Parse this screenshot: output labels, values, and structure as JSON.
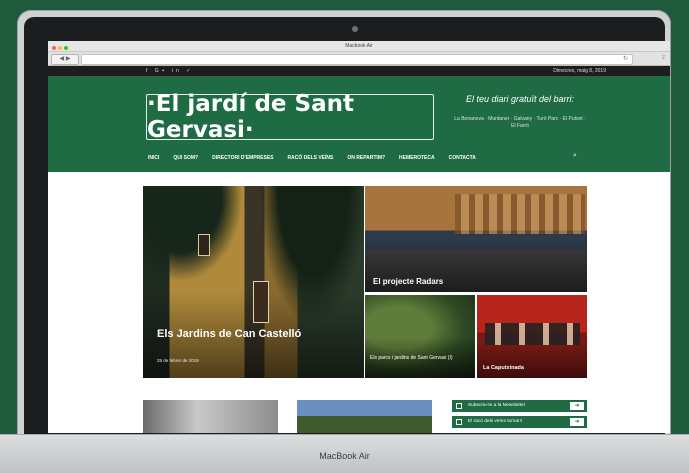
{
  "browser": {
    "window_title": "Macbook Air"
  },
  "site": {
    "social_icons": [
      "facebook-icon",
      "google-plus-icon",
      "linkedin-icon",
      "twitter-icon"
    ],
    "social_glyphs": "f G+ in ✓",
    "date": "Dimecres, maig 8, 2019",
    "logo": "·El jardí de Sant Gervasi·",
    "tagline": "El teu diari gratuït del barri:",
    "tagline_sub": "La Bonanova · Muntaner · Galvany · Turó Parc · El Putxet · El Farró",
    "nav": [
      "INICI",
      "QUI SOM?",
      "DIRECTORI D'EMPRESES",
      "RACÓ DELS VEÏNS",
      "ON REPARTIM?",
      "HEMEROTECA",
      "CONTACTA"
    ]
  },
  "articles": {
    "featured_title": "Els Jardins de Can Castelló",
    "featured_date": "25 de febrer de 2019",
    "radars_title": "El projecte Radars",
    "parcs_title": "Els parcs i jardins de Sant Gervasi (I)",
    "caputxinada_title": "La Caputxinada"
  },
  "sidebar": {
    "newsletter_label": "Subscriu-te a la Newsletter",
    "more_label": "El racó dels veïns torna!!!"
  },
  "device": {
    "label": "MacBook Air"
  },
  "colors": {
    "brand_green": "#1f6b44",
    "background": "#1f5a3c"
  }
}
